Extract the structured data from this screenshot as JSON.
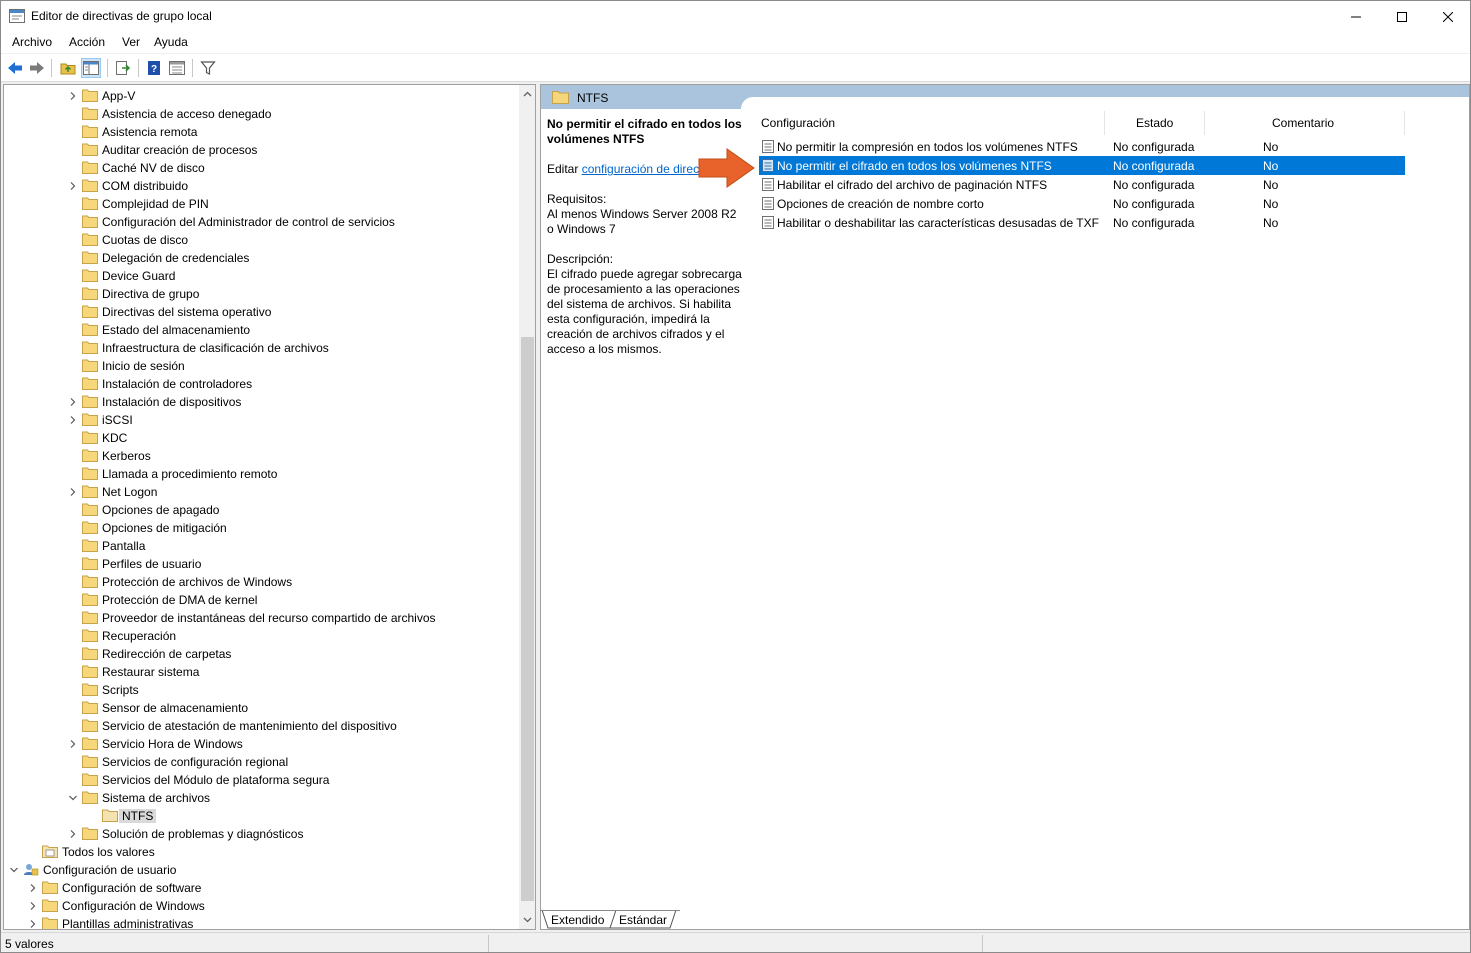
{
  "window": {
    "title": "Editor de directivas de grupo local"
  },
  "menu": [
    "Archivo",
    "Acción",
    "Ver",
    "Ayuda"
  ],
  "tree": {
    "items": [
      {
        "label": "App-V",
        "expander": "collapsed",
        "level": 2
      },
      {
        "label": "Asistencia de acceso denegado",
        "expander": "none",
        "level": 2
      },
      {
        "label": "Asistencia remota",
        "expander": "none",
        "level": 2
      },
      {
        "label": "Auditar creación de procesos",
        "expander": "none",
        "level": 2
      },
      {
        "label": "Caché NV de disco",
        "expander": "none",
        "level": 2
      },
      {
        "label": "COM distribuido",
        "expander": "collapsed",
        "level": 2
      },
      {
        "label": "Complejidad de PIN",
        "expander": "none",
        "level": 2
      },
      {
        "label": "Configuración del Administrador de control de servicios",
        "expander": "none",
        "level": 2
      },
      {
        "label": "Cuotas de disco",
        "expander": "none",
        "level": 2
      },
      {
        "label": "Delegación de credenciales",
        "expander": "none",
        "level": 2
      },
      {
        "label": "Device Guard",
        "expander": "none",
        "level": 2
      },
      {
        "label": "Directiva de grupo",
        "expander": "none",
        "level": 2
      },
      {
        "label": "Directivas del sistema operativo",
        "expander": "none",
        "level": 2
      },
      {
        "label": "Estado del almacenamiento",
        "expander": "none",
        "level": 2
      },
      {
        "label": "Infraestructura de clasificación de archivos",
        "expander": "none",
        "level": 2
      },
      {
        "label": "Inicio de sesión",
        "expander": "none",
        "level": 2
      },
      {
        "label": "Instalación de controladores",
        "expander": "none",
        "level": 2
      },
      {
        "label": "Instalación de dispositivos",
        "expander": "collapsed",
        "level": 2
      },
      {
        "label": "iSCSI",
        "expander": "collapsed",
        "level": 2
      },
      {
        "label": "KDC",
        "expander": "none",
        "level": 2
      },
      {
        "label": "Kerberos",
        "expander": "none",
        "level": 2
      },
      {
        "label": "Llamada a procedimiento remoto",
        "expander": "none",
        "level": 2
      },
      {
        "label": "Net Logon",
        "expander": "collapsed",
        "level": 2
      },
      {
        "label": "Opciones de apagado",
        "expander": "none",
        "level": 2
      },
      {
        "label": "Opciones de mitigación",
        "expander": "none",
        "level": 2
      },
      {
        "label": "Pantalla",
        "expander": "none",
        "level": 2
      },
      {
        "label": "Perfiles de usuario",
        "expander": "none",
        "level": 2
      },
      {
        "label": "Protección de archivos de Windows",
        "expander": "none",
        "level": 2
      },
      {
        "label": "Protección de DMA de kernel",
        "expander": "none",
        "level": 2
      },
      {
        "label": "Proveedor de instantáneas del recurso compartido de archivos",
        "expander": "none",
        "level": 2
      },
      {
        "label": "Recuperación",
        "expander": "none",
        "level": 2
      },
      {
        "label": "Redirección de carpetas",
        "expander": "none",
        "level": 2
      },
      {
        "label": "Restaurar sistema",
        "expander": "none",
        "level": 2
      },
      {
        "label": "Scripts",
        "expander": "none",
        "level": 2
      },
      {
        "label": "Sensor de almacenamiento",
        "expander": "none",
        "level": 2
      },
      {
        "label": "Servicio de atestación de mantenimiento del dispositivo",
        "expander": "none",
        "level": 2
      },
      {
        "label": "Servicio Hora de Windows",
        "expander": "collapsed",
        "level": 2
      },
      {
        "label": "Servicios de configuración regional",
        "expander": "none",
        "level": 2
      },
      {
        "label": "Servicios del Módulo de plataforma segura",
        "expander": "none",
        "level": 2
      },
      {
        "label": "Sistema de archivos",
        "expander": "expanded",
        "level": 2
      },
      {
        "label": "NTFS",
        "expander": "none",
        "level": 3,
        "selected": true
      },
      {
        "label": "Solución de problemas y diagnósticos",
        "expander": "collapsed",
        "level": 2
      },
      {
        "label": "Todos los valores",
        "expander": "none",
        "level": 1,
        "icon": "settings-folder"
      },
      {
        "label": "Configuración de usuario",
        "expander": "expanded",
        "level": 0,
        "icon": "user"
      },
      {
        "label": "Configuración de software",
        "expander": "collapsed",
        "level": 1
      },
      {
        "label": "Configuración de Windows",
        "expander": "collapsed",
        "level": 1
      },
      {
        "label": "Plantillas administrativas",
        "expander": "collapsed",
        "level": 1
      }
    ]
  },
  "header": {
    "folder_name": "NTFS"
  },
  "description": {
    "title": "No permitir el cifrado en todos los volúmenes NTFS",
    "edit_prefix": "Editar ",
    "edit_link": "configuración de directiva",
    "requirements_label": "Requisitos:",
    "requirements_text": "Al menos Windows Server 2008 R2 o Windows 7",
    "description_label": "Descripción:",
    "description_text": "El cifrado puede agregar sobrecarga de procesamiento a las operaciones del sistema de archivos.  Si habilita esta configuración, impedirá la creación de archivos cifrados y el acceso a los mismos."
  },
  "list": {
    "columns": [
      "Configuración",
      "Estado",
      "Comentario"
    ],
    "rows": [
      {
        "name": "No permitir la compresión en todos los volúmenes NTFS",
        "state": "No configurada",
        "comment": "No",
        "selected": false
      },
      {
        "name": "No permitir el cifrado en todos los volúmenes NTFS",
        "state": "No configurada",
        "comment": "No",
        "selected": true
      },
      {
        "name": "Habilitar el cifrado del archivo de paginación NTFS",
        "state": "No configurada",
        "comment": "No",
        "selected": false
      },
      {
        "name": "Opciones de creación de nombre corto",
        "state": "No configurada",
        "comment": "No",
        "selected": false
      },
      {
        "name": "Habilitar o deshabilitar las características desusadas de TXF",
        "state": "No configurada",
        "comment": "No",
        "selected": false
      }
    ]
  },
  "tabs": [
    "Extendido",
    "Estándar"
  ],
  "status": {
    "text": "5 valores"
  },
  "colors": {
    "selection": "#0078d7",
    "header_band": "#a9c4dc",
    "arrow": "#e8622c",
    "link": "#0066cc"
  }
}
